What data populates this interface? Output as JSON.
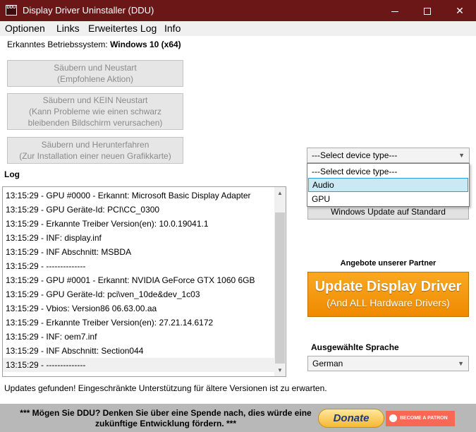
{
  "window": {
    "title": "Display Driver Uninstaller (DDU)",
    "icon_text": "DDU",
    "close_glyph": "✕"
  },
  "menu": [
    "Optionen",
    "Links",
    "Erweitertes Log",
    "Info"
  ],
  "os": {
    "label": "Erkanntes Betriebssystem:",
    "value": "Windows 10 (x64)"
  },
  "actions": [
    {
      "line1": "Säubern und Neustart",
      "line2": "(Empfohlene Aktion)",
      "line3": ""
    },
    {
      "line1": "Säubern und KEIN Neustart",
      "line2": "(Kann Probleme wie einen schwarz",
      "line3": "bleibenden Bildschirm verursachen)"
    },
    {
      "line1": "Säubern und Herunterfahren",
      "line2": "(Zur Installation einer neuen Grafikkarte)",
      "line3": ""
    }
  ],
  "log": {
    "label": "Log",
    "entries": [
      "13:15:29 - GPU #0000 - Erkannt: Microsoft Basic Display Adapter",
      "13:15:29 - GPU Geräte-Id: PCI\\CC_0300",
      "13:15:29 - Erkannte Treiber Version(en): 10.0.19041.1",
      "13:15:29 - INF: display.inf",
      "13:15:29 - INF Abschnitt: MSBDA",
      "13:15:29 - --------------",
      "13:15:29 - GPU #0001 - Erkannt: NVIDIA GeForce GTX 1060 6GB",
      "13:15:29 - GPU Geräte-Id: pci\\ven_10de&dev_1c03",
      "13:15:29 - Vbios: Version86 06.63.00.aa",
      "13:15:29 - Erkannte Treiber Version(en): 27.21.14.6172",
      "13:15:29 - INF: oem7.inf",
      "13:15:29 - INF Abschnitt: Section044",
      "13:15:29 - --------------"
    ],
    "selected_index": 12
  },
  "status": "Updates gefunden! Eingeschränkte Unterstützung für ältere Versionen ist zu erwarten.",
  "device_type": {
    "selected": "---Select device type---",
    "options": [
      "---Select device type---",
      "Audio",
      "GPU"
    ],
    "highlighted_index": 1
  },
  "windows_update_button": "Windows Update auf Standard",
  "partner": {
    "label": "Angebote unserer Partner",
    "banner_line1": "Update Display Driver",
    "banner_line2": "(And ALL Hardware Drivers)"
  },
  "language": {
    "label": "Ausgewählte Sprache",
    "value": "German"
  },
  "footer": {
    "text_line1": "*** Mögen Sie DDU? Denken Sie über eine Spende nach, dies würde eine",
    "text_line2": "zukünftige Entwicklung fördern. ***",
    "donate": "Donate",
    "patron": "BECOME A PATRON"
  },
  "colors": {
    "titlebar": "#6b1718",
    "banner_orange": "#f39200",
    "patreon": "#f96854",
    "highlight": "#cce8f3"
  }
}
